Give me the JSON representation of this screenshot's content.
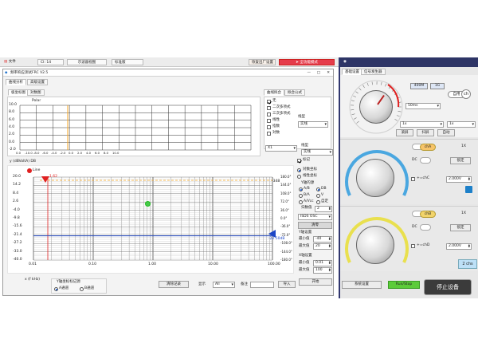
{
  "toolbar": {
    "file_menu": "文件",
    "cd_select": "CI: 14",
    "waveform_btn": "示波器视图",
    "mode_select": "标准版",
    "restore_btn": "恢复出厂设置",
    "fullscreen_btn": "全功能模式",
    "device_title": "示波器信号源ISDS205A",
    "help_btn": "帮助"
  },
  "main": {
    "title": "频率响应测试FRC V2.5",
    "tabs": [
      "曲线分析",
      "高级设置"
    ],
    "subtabs": [
      "极坐标图",
      "对数图"
    ],
    "polar_label": "Polar",
    "polar_y_ticks": [
      "10.0",
      "8.0",
      "6.0",
      "4.0",
      "2.0",
      "0.0",
      "-2.0"
    ],
    "polar_x_ticks": [
      "0.0",
      "-10.0",
      "-8.0",
      "-6.0",
      "-4.0",
      "-2.0",
      "0.0",
      "2.0",
      "4.0",
      "6.0",
      "8.0",
      "10.0"
    ],
    "curve_fit_tabs": [
      "曲线拟合",
      "拟合公式"
    ],
    "fit_options": [
      {
        "label": "无",
        "checked": true
      },
      {
        "label": "二次多项式",
        "checked": false
      },
      {
        "label": "三次多项式",
        "checked": false
      },
      {
        "label": "线性",
        "checked": false
      },
      {
        "label": "指数",
        "checked": false
      },
      {
        "label": "对数",
        "checked": false
      }
    ],
    "line_type_label": "线型",
    "line_type_value": "实线",
    "x1_value": "X1",
    "line_type2_label": "线型",
    "line_type2_value": "实线",
    "mark_check": "标记",
    "y_axis_title": "y (dBVoltA) DB",
    "amp_x_ticks": [
      "0.01",
      "0.10",
      "1.00",
      "10.00",
      "100.00"
    ],
    "amp_x_label": "x (f kHz)",
    "left_y_ticks": [
      "20.0",
      "14.2",
      "8.4",
      "2.6",
      "-4.0",
      "-9.8",
      "-15.6",
      "-21.4",
      "-27.2",
      "-33.0",
      "-40.0"
    ],
    "right_y_ticks": [
      "180.0°",
      "144.0°",
      "108.0°",
      "72.0°",
      "36.0°",
      "0.0°",
      "-36.0°",
      "-72.0°",
      "-108.0°",
      "-144.0°",
      "-180.0°"
    ],
    "marker_label": "1.62",
    "right_marker_top": "-348",
    "right_marker_value": "-22.50dB",
    "legend_label": "Line",
    "scale_options": [
      {
        "label": "对数坐标",
        "checked": true
      },
      {
        "label": "线性坐标",
        "checked": false
      }
    ],
    "y_source_label": "Y轴的源",
    "y_options": [
      "A/B",
      "DB",
      "B/A",
      "V",
      "A/Vcc",
      "自定"
    ],
    "y_custom_label": "归数值",
    "y_custom_value": "2",
    "osc_select": "ISDS OSC",
    "clear_btn": "清零",
    "y_settings_label": "Y轴设置",
    "y_min_label": "最小值",
    "y_min_value": "-40",
    "y_max_label": "最大值",
    "y_max_value": "20",
    "x_settings_label": "X轴设置",
    "x_min_label": "最小值",
    "x_min_value": "0.01",
    "x_max_label": "最大值",
    "x_max_value": "100",
    "start_btn": "开始",
    "ylock_label": "Y轴坐标标记源",
    "ylock_opt1": "A通道",
    "ylock_opt2": "B通道",
    "clear_record_btn": "清除记录",
    "display_label": "显示",
    "display_value": "All",
    "note_label": "备注",
    "import_btn": "导入"
  },
  "device": {
    "tabs": [
      "基础设置",
      "信号发生器"
    ],
    "freq_value": "400M",
    "unit_value": "1G",
    "auto_btn": "自用",
    "ch_btn": "ch",
    "time_select": "50ms",
    "time_select2": "1x",
    "time_select3": "1x",
    "btn_row": [
      "滚屏",
      "扫屏",
      "自动"
    ],
    "chA_label": "chA",
    "chA_scale": "1X",
    "chA_dc": "DC",
    "chA_lock": "锁定",
    "chC_label": "chC",
    "chC_volt": "2.000V",
    "chB_label": "chB",
    "chB_scale": "1X",
    "chB_dc": "DC",
    "chB_lock": "锁定",
    "chD_label": "chD",
    "chD_volt": "2.000V",
    "chs_label": "2 chs",
    "system_btn": "系统设置",
    "runstop_btn": "Run/Stop",
    "stop_device_btn": "停止设备",
    "dial_labels": [
      "500ms",
      "200ms",
      "100ms",
      "50ms",
      "20ms",
      "10ms",
      "5ms",
      "2ms",
      "1ms",
      "500us",
      "200us",
      "100us",
      "50us",
      "20us",
      "10us"
    ],
    "knob_a_labels": [
      "1V",
      "500mV",
      "200mV",
      "100mV",
      "50mV",
      "20mV",
      "10mV",
      "2V",
      "5V",
      "10V"
    ],
    "knob_b_labels": [
      "1V",
      "500mV",
      "200mV",
      "100mV",
      "50mV",
      "20mV",
      "10mV",
      "2V",
      "5V",
      "10V"
    ]
  },
  "colors": {
    "accent_red": "#e02020",
    "curve_blue": "#2a4fc9",
    "curve_orange": "#f5a623",
    "gauge_blue": "#4aa7e0",
    "gauge_yellow": "#e9e04e",
    "run_green": "#5ccc3a",
    "title_navy": "#2e3566"
  }
}
